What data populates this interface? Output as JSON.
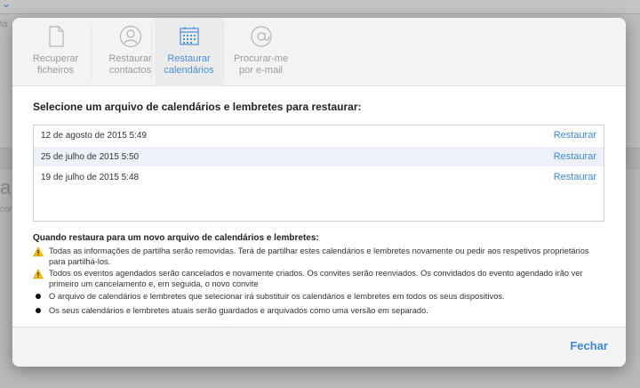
{
  "tabs": [
    {
      "id": "files",
      "line1": "Recuperar",
      "line2": "ficheiros",
      "icon": "document-icon"
    },
    {
      "id": "contacts",
      "line1": "Restaurar",
      "line2": "contactos",
      "icon": "contact-icon"
    },
    {
      "id": "calendars",
      "line1": "Restaurar",
      "line2": "calendários",
      "icon": "calendar-icon",
      "active": true
    },
    {
      "id": "email",
      "line1": "Procurar-me",
      "line2": "por e-mail",
      "icon": "at-sign-icon"
    }
  ],
  "content": {
    "heading": "Selecione um arquivo de calendários e lembretes para restaurar:",
    "archives": [
      {
        "date": "12 de agosto de 2015 5:49",
        "action": "Restaurar"
      },
      {
        "date": "25 de julho de 2015 5:50",
        "action": "Restaurar"
      },
      {
        "date": "19 de julho de 2015 5:48",
        "action": "Restaurar"
      }
    ],
    "notes_title": "Quando restaura para um novo arquivo de calendários e lembretes:",
    "notes": [
      {
        "type": "warning",
        "text": "Todas as informações de partilha serão removidas. Terá de partilhar estes calendários e lembretes novamente ou pedir aos respetivos proprietários para partilhá-los."
      },
      {
        "type": "warning",
        "text": "Todos os eventos agendados serão cancelados e novamente criados. Os convites serão reenviados. Os convidados do evento agendado irão ver primeiro um cancelamento e, em seguida, o novo convite"
      },
      {
        "type": "bullet",
        "text": "O arquivo de calendários e lembretes que selecionar irá substituir os calendários e lembretes em todos os seus dispositivos."
      },
      {
        "type": "bullet",
        "text": "Os seus calendários e lembretes atuais serão guardados e arquivados como uma versão em separado."
      }
    ]
  },
  "footer": {
    "close_label": "Fechar"
  },
  "background": {
    "frag1": "tá",
    "frag2": "a",
    "frag3": "con"
  },
  "colors": {
    "accent": "#3d89d6",
    "warning": "#f5c400"
  }
}
